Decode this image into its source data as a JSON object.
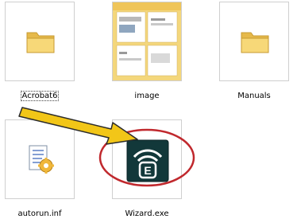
{
  "files": [
    {
      "name": "Acrobat6",
      "type": "folder-icon"
    },
    {
      "name": "image",
      "type": "folder-with-thumbnails-icon"
    },
    {
      "name": "Manuals",
      "type": "folder-icon"
    },
    {
      "name": "autorun.inf",
      "type": "autorun-settings-icon"
    },
    {
      "name": "Wizard.exe",
      "type": "wizard-app-icon"
    }
  ],
  "wizard_icon_letter": "E",
  "colors": {
    "folder_body": "#f7d878",
    "folder_tab": "#e6b94a",
    "arrow": "#f2c618",
    "highlight_ring": "#c0282d",
    "wizard_bg": "#12383a"
  }
}
